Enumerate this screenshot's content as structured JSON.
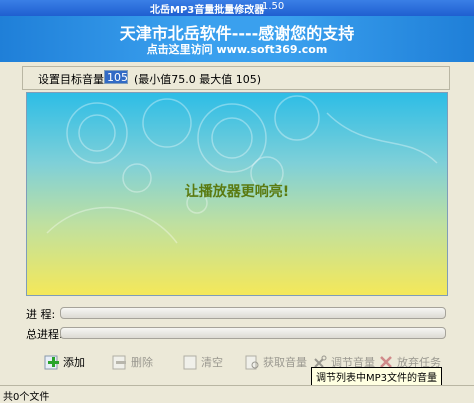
{
  "window": {
    "title": "北岳MP3音量批量修改器",
    "version": "1.50"
  },
  "banner": {
    "headline": "天津市北岳软件----感谢您的支持",
    "subline": "点击这里访问 www.soft369.com"
  },
  "settings": {
    "label": "设置目标音量",
    "value": "105",
    "range_text": "(最小值75.0  最大值 105)"
  },
  "art": {
    "slogan": "让播放器更响亮!"
  },
  "progress": {
    "label": "进  程:",
    "value": 0
  },
  "total_progress": {
    "label": "总进程:",
    "value": 0
  },
  "toolbar": {
    "add": "添加",
    "delete": "删除",
    "clear": "清空",
    "get_volume": "获取音量",
    "adjust_volume": "调节音量",
    "abandon_task": "放弃任务"
  },
  "tooltip": "调节列表中MP3文件的音量",
  "status": {
    "text": "共0个文件"
  },
  "colors": {
    "title_blue": "#1f5fd0",
    "banner_blue": "#3aa0ee",
    "art_top": "#2dbde6",
    "art_bottom": "#f4e85a"
  }
}
